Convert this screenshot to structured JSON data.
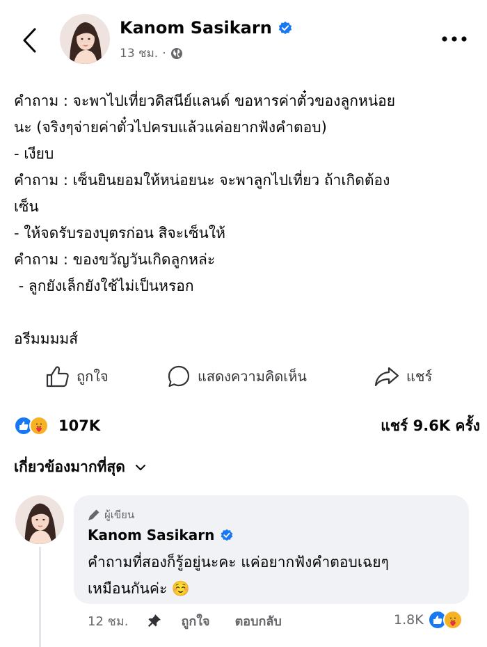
{
  "post": {
    "author": "Kanom Sasikarn",
    "time": "13 ชม.",
    "separator": "·",
    "body_lines": [
      "คำถาม : จะพาไปเที่ยวดิสนีย์แลนด์ ขอหารค่าตั๋วของลูกหน่อย",
      "นะ (จริงๆจ่ายค่าตั๋วไปครบแล้วแค่อยากฟังคำตอบ)",
      "- เงียบ",
      "คำถาม : เซ็นยินยอมให้หน่อยนะ จะพาลูกไปเที่ยว ถ้าเกิดต้อง",
      "เซ็น",
      "- ให้จดรับรองบุตรก่อน สิจะเซ็นให้",
      "คำถาม : ของขวัญวันเกิดลูกหล่ะ",
      " - ลูกยังเล็กยังใช้ไม่เป็นหรอก",
      "",
      "อรีมมมมส์"
    ]
  },
  "actions": {
    "like": "ถูกใจ",
    "comment": "แสดงความคิดเห็น",
    "share": "แชร์"
  },
  "stats": {
    "reactions_count": "107K",
    "shares": "แชร์ 9.6K ครั้ง"
  },
  "sort": {
    "label": "เกี่ยวข้องมากที่สุด"
  },
  "comment": {
    "badge": "ผู้เขียน",
    "author": "Kanom Sasikarn",
    "text_lines": [
      "คำถามที่สองก็รู้อยู่นะคะ แค่อยากฟังคำตอบเฉยๆ",
      "เหมือนกันค่ะ ☺️"
    ],
    "time": "12 ชม.",
    "like": "ถูกใจ",
    "reply": "ตอบกลับ",
    "reactions_count": "1.8K"
  },
  "colors": {
    "facebook_blue": "#1877f2",
    "care_yellow": "#f7b125",
    "secondary_text": "#65676b",
    "bubble_bg": "#f0f2f5"
  },
  "icons": {
    "back": "back-arrow-icon",
    "more": "more-dots-icon",
    "audience": "globe-icon",
    "verified": "verified-badge-icon",
    "like": "thumbs-up-icon",
    "comment": "comment-bubble-icon",
    "share": "share-arrow-icon",
    "author_badge": "pen-icon",
    "pin": "pin-icon",
    "sort": "chevron-down-icon"
  }
}
